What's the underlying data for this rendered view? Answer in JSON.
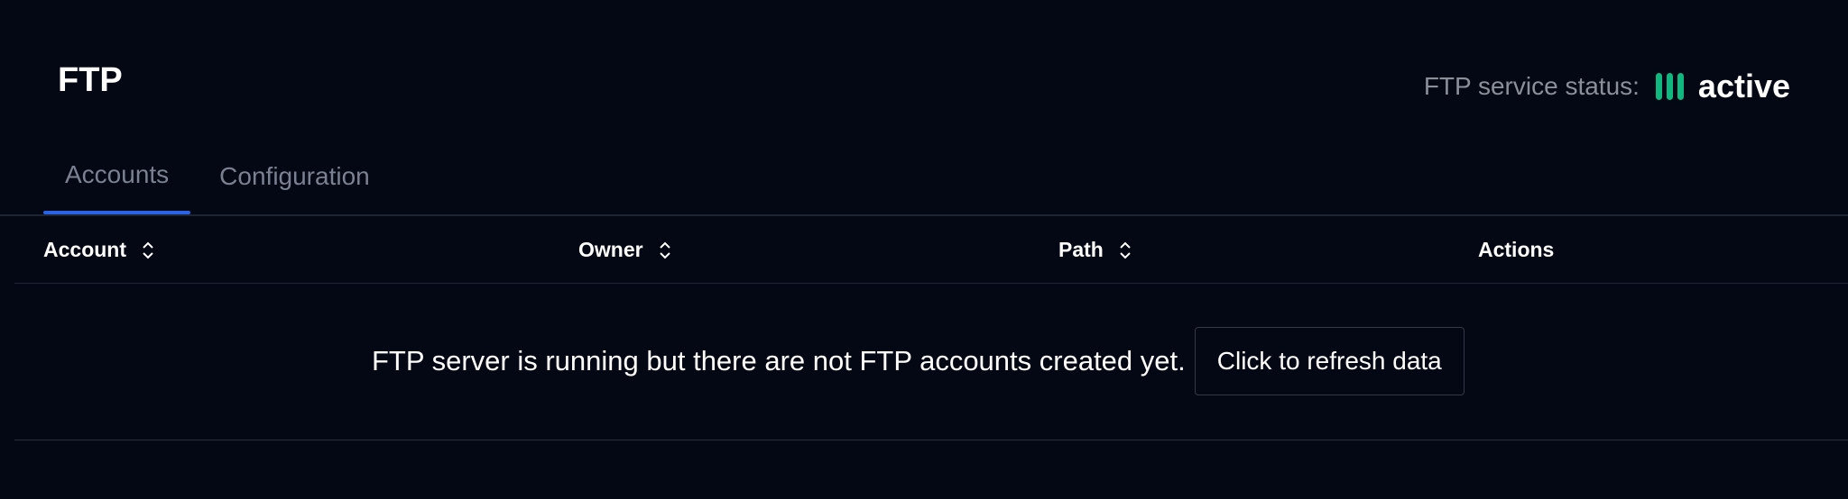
{
  "page": {
    "title": "FTP"
  },
  "service_status": {
    "label": "FTP service status:",
    "value": "active",
    "color": "#10b87f"
  },
  "tabs": [
    {
      "label": "Accounts",
      "active": true
    },
    {
      "label": "Configuration",
      "active": false
    }
  ],
  "table": {
    "columns": [
      {
        "label": "Account",
        "sortable": true
      },
      {
        "label": "Owner",
        "sortable": true
      },
      {
        "label": "Path",
        "sortable": true
      },
      {
        "label": "Actions",
        "sortable": false
      }
    ],
    "empty_message": "FTP server is running but there are not FTP accounts created yet.",
    "refresh_label": "Click to refresh data"
  },
  "colors": {
    "background": "#040814",
    "tab_indicator": "#2b63e6",
    "muted_text": "#7b8191"
  }
}
